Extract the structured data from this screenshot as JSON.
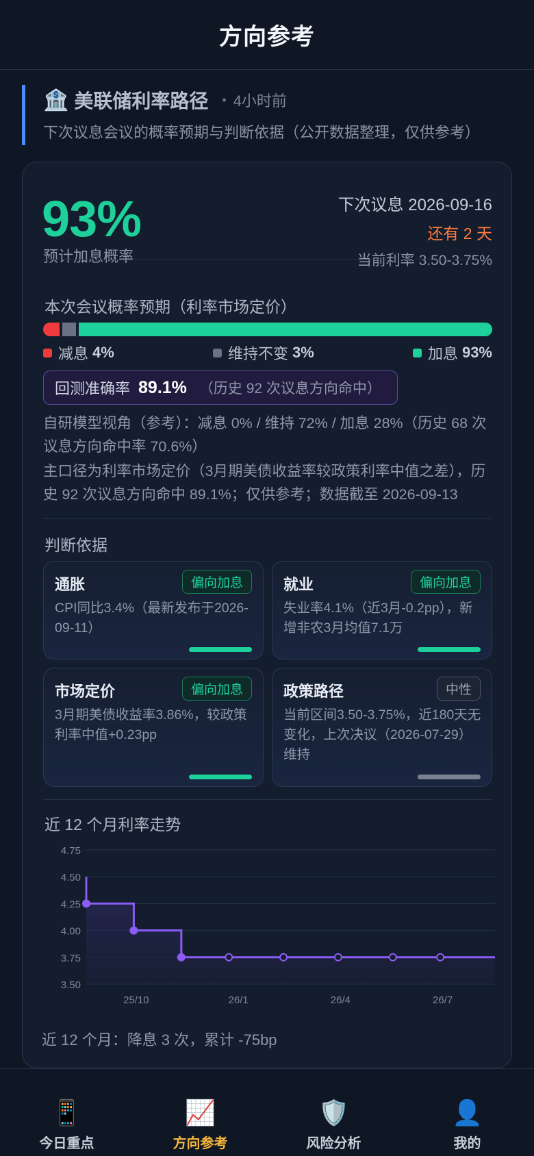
{
  "header": {
    "title": "方向参考"
  },
  "section": {
    "icon": "🏦",
    "title": "美联储利率路径",
    "dot": "•",
    "time": "4小时前",
    "subtitle": "下次议息会议的概率预期与判断依据（公开数据整理，仅供参考）"
  },
  "summary": {
    "probability": "93%",
    "probability_label": "预计加息概率",
    "next_meeting": "下次议息 2026-09-16",
    "countdown": "还有 2 天",
    "current_rate": "当前利率 3.50-3.75%"
  },
  "probabilities": {
    "title": "本次会议概率预期（利率市场定价）",
    "cut": {
      "label": "减息",
      "value": "4%",
      "pct": 4,
      "color": "#ef3b3b"
    },
    "hold": {
      "label": "维持不变",
      "value": "3%",
      "pct": 3,
      "color": "#6a7385"
    },
    "hike": {
      "label": "加息",
      "value": "93%",
      "pct": 93,
      "color": "#1ed19a"
    }
  },
  "accuracy": {
    "label": "回测准确率",
    "value": "89.1%",
    "note": "（历史 92 次议息方向命中）"
  },
  "model_note": "自研模型视角（参考）：减息 0% / 维持 72% / 加息 28%（历史 68 次议息方向命中率 70.6%）",
  "method_note": "主口径为利率市场定价（3月期美债收益率较政策利率中值之差），历史 92 次议息方向命中 89.1%；仅供参考；数据截至 2026-09-13",
  "basis": {
    "title": "判断依据",
    "items": [
      {
        "title": "通胀",
        "tag": "偏向加息",
        "text": "CPI同比3.4%（最新发布于2026-09-11）"
      },
      {
        "title": "就业",
        "tag": "偏向加息",
        "text": "失业率4.1%（近3月-0.2pp），新增非农3月均值7.1万"
      },
      {
        "title": "市场定价",
        "tag": "偏向加息",
        "text": "3月期美债收益率3.86%，较政策利率中值+0.23pp"
      },
      {
        "title": "政策路径",
        "tag": "中性",
        "text": "当前区间3.50-3.75%，近180天无变化，上次决议（2026-07-29）维持"
      }
    ]
  },
  "trend": {
    "title": "近 12 个月利率走势",
    "summary": "近 12 个月：降息 3 次，累计 -75bp"
  },
  "chart_data": {
    "type": "line",
    "step": true,
    "title": "近 12 个月利率走势",
    "xlabel": "",
    "ylabel": "",
    "ylim": [
      3.5,
      4.75
    ],
    "yticks": [
      "4.75",
      "4.50",
      "4.25",
      "4.00",
      "3.75",
      "3.50"
    ],
    "xtick_labels": [
      "25/10",
      "26/1",
      "26/4",
      "26/7"
    ],
    "xtick_months": [
      1,
      4,
      7,
      10
    ],
    "x_months": [
      0,
      0,
      1,
      2,
      3,
      4,
      5,
      6,
      7,
      8
    ],
    "x_end_month": 8.6,
    "values": [
      4.5,
      4.25,
      4.0,
      3.75,
      3.75,
      3.75,
      3.75,
      3.75,
      3.75,
      3.75
    ],
    "markers": [
      {
        "month": 0,
        "value": 4.25,
        "filled": true
      },
      {
        "month": 1,
        "value": 4.0,
        "filled": true
      },
      {
        "month": 2,
        "value": 3.75,
        "filled": true
      },
      {
        "month": 3,
        "value": 3.75,
        "filled": false
      },
      {
        "month": 4.15,
        "value": 3.75,
        "filled": false
      },
      {
        "month": 5.3,
        "value": 3.75,
        "filled": false
      },
      {
        "month": 6.45,
        "value": 3.75,
        "filled": false
      },
      {
        "month": 7.45,
        "value": 3.75,
        "filled": false
      }
    ],
    "color": "#8b5cf6",
    "grid": true
  },
  "nav": {
    "items": [
      {
        "icon": "📱",
        "icon_name": "phone-icon",
        "label": "今日重点"
      },
      {
        "icon": "📈",
        "icon_name": "trend-chart-icon",
        "label": "方向参考"
      },
      {
        "icon": "🛡️",
        "icon_name": "shield-icon",
        "label": "风险分析"
      },
      {
        "icon": "👤",
        "icon_name": "user-icon",
        "label": "我的"
      }
    ]
  }
}
